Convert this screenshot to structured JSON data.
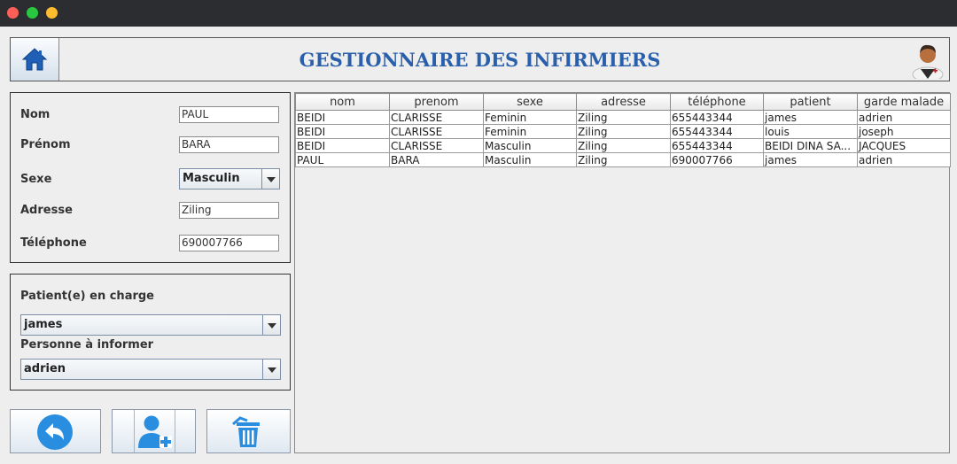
{
  "window": {
    "controls": [
      "close",
      "minimize",
      "zoom"
    ]
  },
  "header": {
    "title": "GESTIONNAIRE DES INFIRMIERS",
    "home_icon": "home-icon",
    "avatar_icon": "doctor-icon"
  },
  "form": {
    "nom_label": "Nom",
    "nom_value": "PAUL",
    "prenom_label": "Prénom",
    "prenom_value": "BARA",
    "sexe_label": "Sexe",
    "sexe_value": "Masculin",
    "adresse_label": "Adresse",
    "adresse_value": "Ziling",
    "telephone_label": "Téléphone",
    "telephone_value": "690007766"
  },
  "care": {
    "patient_label": "Patient(e) en charge",
    "patient_value": "james",
    "personne_label": "Personne à informer",
    "personne_value": "adrien"
  },
  "actions": {
    "back_icon": "undo-icon",
    "add_icon": "add-user-icon",
    "delete_icon": "trash-icon"
  },
  "table": {
    "columns": [
      "nom",
      "prenom",
      "sexe",
      "adresse",
      "téléphone",
      "patient",
      "garde malade"
    ],
    "rows": [
      [
        "BEIDI",
        "CLARISSE",
        "Feminin",
        "Ziling",
        "655443344",
        "james",
        "adrien"
      ],
      [
        "BEIDI",
        "CLARISSE",
        "Feminin",
        "Ziling",
        "655443344",
        "louis",
        "joseph"
      ],
      [
        "BEIDI",
        "CLARISSE",
        "Masculin",
        "Ziling",
        "655443344",
        "BEIDI DINA SA...",
        "JACQUES"
      ],
      [
        "PAUL",
        "BARA",
        "Masculin",
        "Ziling",
        "690007766",
        "james",
        "adrien"
      ]
    ]
  },
  "colors": {
    "title": "#2a5fab",
    "accent": "#2a8ee0"
  }
}
